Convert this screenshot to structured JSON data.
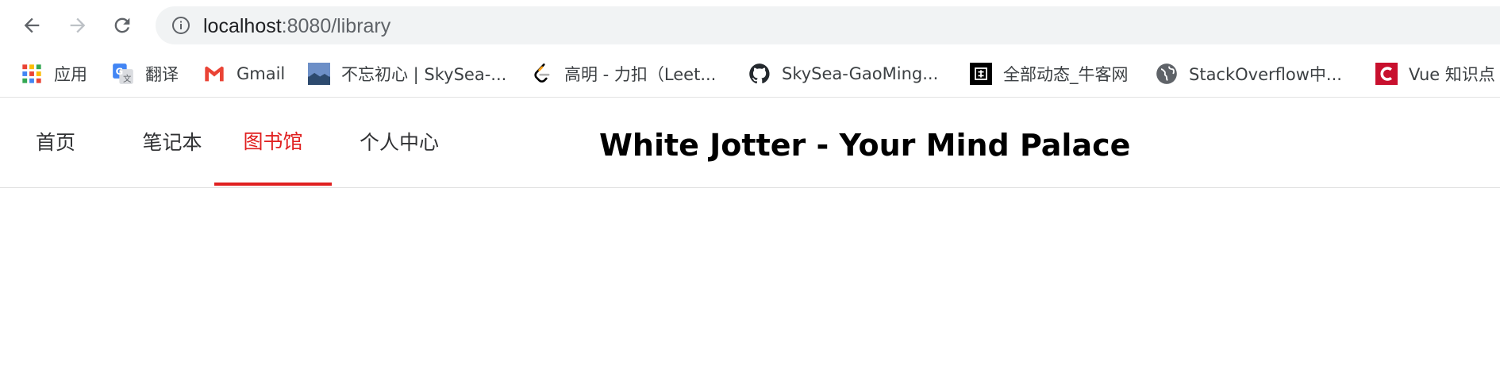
{
  "browser": {
    "url_host": "localhost",
    "url_rest": ":8080/library",
    "icons": {
      "back": "back-arrow-icon",
      "forward": "forward-arrow-icon",
      "reload": "reload-icon",
      "info": "info-icon"
    }
  },
  "bookmarks": [
    {
      "label": "应用",
      "icon": "apps-grid-icon"
    },
    {
      "label": "翻译",
      "icon": "google-translate-icon"
    },
    {
      "label": "Gmail",
      "icon": "gmail-icon"
    },
    {
      "label": "不忘初心 | SkySea-...",
      "icon": "landscape-thumbnail-icon"
    },
    {
      "label": "高明 - 力扣（Leet...",
      "icon": "leetcode-icon"
    },
    {
      "label": "SkySea-GaoMing...",
      "icon": "github-icon"
    },
    {
      "label": "全部动态_牛客网",
      "icon": "nowcoder-icon"
    },
    {
      "label": "StackOverflow中...",
      "icon": "globe-icon"
    },
    {
      "label": "Vue 知识点",
      "icon": "csdn-icon"
    }
  ],
  "site_nav": {
    "items": [
      {
        "label": "首页",
        "active": false
      },
      {
        "label": "笔记本",
        "active": false
      },
      {
        "label": "图书馆",
        "active": true
      },
      {
        "label": "个人中心",
        "active": false
      }
    ],
    "title": "White Jotter - Your Mind Palace",
    "colors": {
      "active": "#e02020",
      "text": "#303133"
    }
  }
}
